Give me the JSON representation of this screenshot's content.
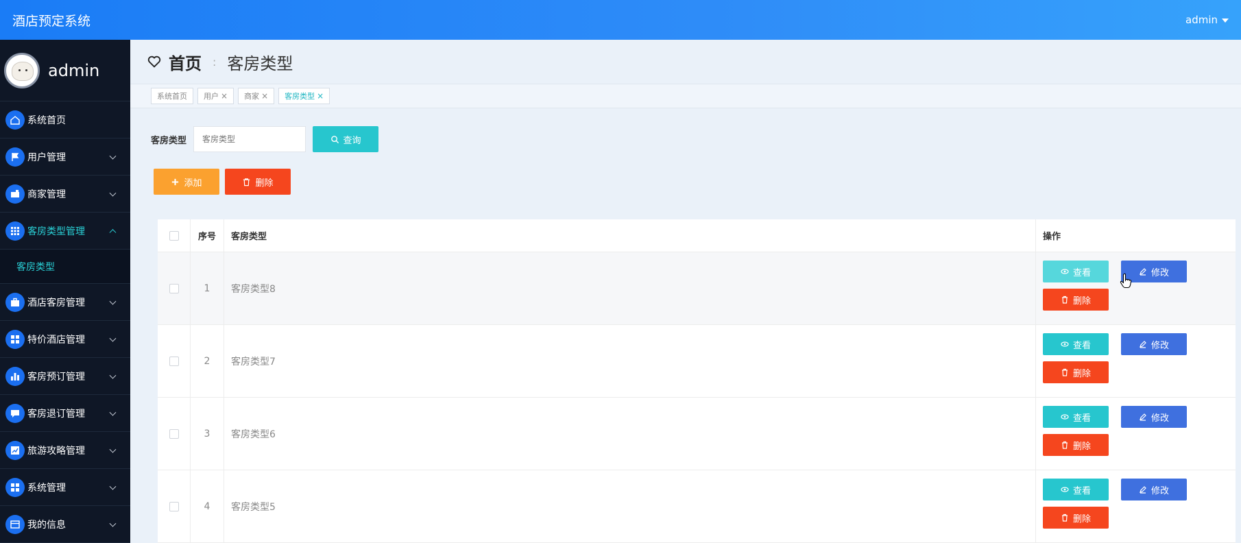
{
  "header": {
    "app_title": "酒店预定系统",
    "user": "admin"
  },
  "sidebar": {
    "profile_name": "admin",
    "items": [
      {
        "label": "系统首页",
        "icon": "home-icon",
        "expandable": false
      },
      {
        "label": "用户管理",
        "icon": "flag-icon",
        "expandable": true
      },
      {
        "label": "商家管理",
        "icon": "wallet-icon",
        "expandable": true
      },
      {
        "label": "客房类型管理",
        "icon": "grid-icon",
        "expandable": true,
        "active": true
      },
      {
        "label": "酒店客房管理",
        "icon": "briefcase-icon",
        "expandable": true
      },
      {
        "label": "特价酒店管理",
        "icon": "apps-icon",
        "expandable": true
      },
      {
        "label": "客房预订管理",
        "icon": "bar-chart-icon",
        "expandable": true
      },
      {
        "label": "客房退订管理",
        "icon": "message-icon",
        "expandable": true
      },
      {
        "label": "旅游攻略管理",
        "icon": "trend-chart-icon",
        "expandable": true
      },
      {
        "label": "系统管理",
        "icon": "apps-icon",
        "expandable": true
      },
      {
        "label": "我的信息",
        "icon": "card-icon",
        "expandable": true
      }
    ],
    "sub_item": "客房类型"
  },
  "breadcrumb": {
    "home": "首页",
    "current": "客房类型"
  },
  "tags": [
    {
      "label": "系统首页",
      "closable": false
    },
    {
      "label": "用户",
      "closable": true
    },
    {
      "label": "商家",
      "closable": true
    },
    {
      "label": "客房类型",
      "closable": true,
      "active": true
    }
  ],
  "search": {
    "label": "客房类型",
    "placeholder": "客房类型",
    "button": "查询"
  },
  "actions": {
    "add": "添加",
    "delete": "删除"
  },
  "table": {
    "columns": {
      "index": "序号",
      "type": "客房类型",
      "ops": "操作"
    },
    "rows": [
      {
        "index": "1",
        "type": "客房类型8"
      },
      {
        "index": "2",
        "type": "客房类型7"
      },
      {
        "index": "3",
        "type": "客房类型6"
      },
      {
        "index": "4",
        "type": "客房类型5"
      }
    ],
    "op_labels": {
      "view": "查看",
      "edit": "修改",
      "delete": "删除"
    }
  },
  "colors": {
    "header": "#1a7cf6",
    "sidebar": "#0f1726",
    "teal": "#27c6ce",
    "blue": "#3f70df",
    "red": "#f5461e",
    "orange": "#fba12f"
  }
}
